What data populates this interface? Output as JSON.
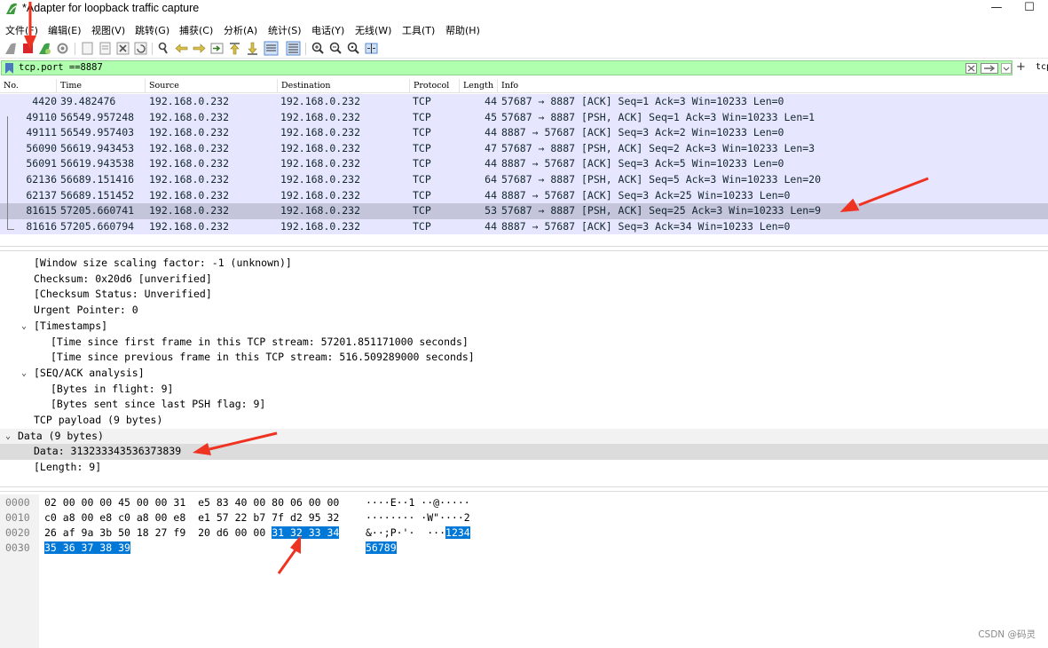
{
  "window": {
    "title": "*Adapter for loopback traffic capture",
    "minimize_label": "—",
    "maximize_label": "☐"
  },
  "menu": [
    "文件(F)",
    "编辑(E)",
    "视图(V)",
    "跳转(G)",
    "捕获(C)",
    "分析(A)",
    "统计(S)",
    "电话(Y)",
    "无线(W)",
    "工具(T)",
    "帮助(H)"
  ],
  "filter": {
    "value": "tcp.port ==8887",
    "add_label": "+",
    "expression_label": "tcp"
  },
  "packet_list": {
    "columns": [
      "No.",
      "Time",
      "Source",
      "Destination",
      "Protocol",
      "Length",
      "Info"
    ],
    "rows": [
      {
        "no": "4420",
        "time": "39.482476",
        "src": "192.168.0.232",
        "dst": "192.168.0.232",
        "proto": "TCP",
        "len": "44",
        "info": "57687 → 8887 [ACK] Seq=1 Ack=3 Win=10233 Len=0"
      },
      {
        "no": "49110",
        "time": "56549.957248",
        "src": "192.168.0.232",
        "dst": "192.168.0.232",
        "proto": "TCP",
        "len": "45",
        "info": "57687 → 8887 [PSH, ACK] Seq=1 Ack=3 Win=10233 Len=1"
      },
      {
        "no": "49111",
        "time": "56549.957403",
        "src": "192.168.0.232",
        "dst": "192.168.0.232",
        "proto": "TCP",
        "len": "44",
        "info": "8887 → 57687 [ACK] Seq=3 Ack=2 Win=10233 Len=0"
      },
      {
        "no": "56090",
        "time": "56619.943453",
        "src": "192.168.0.232",
        "dst": "192.168.0.232",
        "proto": "TCP",
        "len": "47",
        "info": "57687 → 8887 [PSH, ACK] Seq=2 Ack=3 Win=10233 Len=3"
      },
      {
        "no": "56091",
        "time": "56619.943538",
        "src": "192.168.0.232",
        "dst": "192.168.0.232",
        "proto": "TCP",
        "len": "44",
        "info": "8887 → 57687 [ACK] Seq=3 Ack=5 Win=10233 Len=0"
      },
      {
        "no": "62136",
        "time": "56689.151416",
        "src": "192.168.0.232",
        "dst": "192.168.0.232",
        "proto": "TCP",
        "len": "64",
        "info": "57687 → 8887 [PSH, ACK] Seq=5 Ack=3 Win=10233 Len=20"
      },
      {
        "no": "62137",
        "time": "56689.151452",
        "src": "192.168.0.232",
        "dst": "192.168.0.232",
        "proto": "TCP",
        "len": "44",
        "info": "8887 → 57687 [ACK] Seq=3 Ack=25 Win=10233 Len=0"
      },
      {
        "no": "81615",
        "time": "57205.660741",
        "src": "192.168.0.232",
        "dst": "192.168.0.232",
        "proto": "TCP",
        "len": "53",
        "info": "57687 → 8887 [PSH, ACK] Seq=25 Ack=3 Win=10233 Len=9"
      },
      {
        "no": "81616",
        "time": "57205.660794",
        "src": "192.168.0.232",
        "dst": "192.168.0.232",
        "proto": "TCP",
        "len": "44",
        "info": "8887 → 57687 [ACK] Seq=3 Ack=34 Win=10233 Len=0"
      }
    ],
    "selected_no": "81615",
    "row_color": "#e7e6ff",
    "selected_color": "#c4c4db"
  },
  "details": [
    {
      "text": "[Window size scaling factor: -1 (unknown)]",
      "expander": ""
    },
    {
      "text": "Checksum: 0x20d6 [unverified]",
      "expander": ""
    },
    {
      "text": "[Checksum Status: Unverified]",
      "expander": ""
    },
    {
      "text": "Urgent Pointer: 0",
      "expander": ""
    },
    {
      "text": "[Timestamps]",
      "expander": "expanded"
    },
    {
      "text": "[Time since first frame in this TCP stream: 57201.851171000 seconds]",
      "expander": ""
    },
    {
      "text": "[Time since previous frame in this TCP stream: 516.509289000 seconds]",
      "expander": ""
    },
    {
      "text": "[SEQ/ACK analysis]",
      "expander": "expanded"
    },
    {
      "text": "[Bytes in flight: 9]",
      "expander": ""
    },
    {
      "text": "[Bytes sent since last PSH flag: 9]",
      "expander": ""
    },
    {
      "text": "TCP payload (9 bytes)",
      "expander": ""
    },
    {
      "text": "Data (9 bytes)",
      "expander": "expanded"
    },
    {
      "text": "Data: 313233343536373839",
      "expander": ""
    },
    {
      "text": "[Length: 9]",
      "expander": ""
    }
  ],
  "bytes": [
    {
      "offset": "0000",
      "hex_a": "02 00 00 00 45 00 00 31  e5 83 40 00 80 06 00 00",
      "hex_hl": "",
      "asc_a": "····E··1 ··@·····",
      "asc_hl": ""
    },
    {
      "offset": "0010",
      "hex_a": "c0 a8 00 e8 c0 a8 00 e8  e1 57 22 b7 7f d2 95 32",
      "hex_hl": "",
      "asc_a": "········ ·W\"····2",
      "asc_hl": ""
    },
    {
      "offset": "0020",
      "hex_a": "26 af 9a 3b 50 18 27 f9  20 d6 00 00 ",
      "hex_hl": "31 32 33 34",
      "asc_a": "&··;P·'·  ···",
      "asc_hl": "1234"
    },
    {
      "offset": "0030",
      "hex_a": "",
      "hex_hl": "35 36 37 38 39",
      "asc_a": "",
      "asc_hl": "56789"
    }
  ],
  "watermark": "CSDN @码灵",
  "colors": {
    "filter_valid": "#afffaf",
    "bytes_highlight": "#0078d7",
    "annotation_arrow": "#ee3322"
  }
}
